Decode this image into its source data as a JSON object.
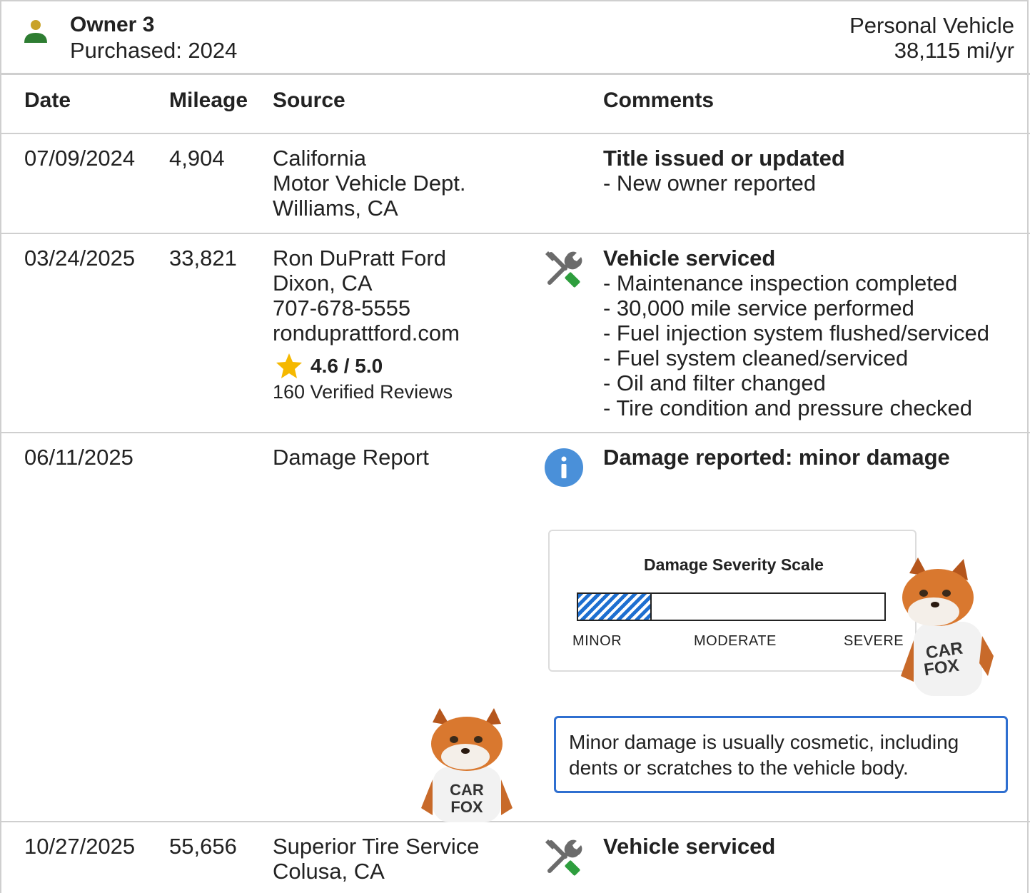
{
  "owner": {
    "title": "Owner 3",
    "purchased": "Purchased: 2024",
    "vehicle_type": "Personal Vehicle",
    "mileage_rate": "38,115 mi/yr"
  },
  "columns": {
    "date": "Date",
    "mileage": "Mileage",
    "source": "Source",
    "comments": "Comments"
  },
  "records": [
    {
      "date": "07/09/2024",
      "mileage": "4,904",
      "source": [
        "California",
        "Motor Vehicle Dept.",
        "Williams, CA"
      ],
      "comment_title": "Title issued or updated",
      "comment_items": [
        "- New owner reported"
      ]
    },
    {
      "date": "03/24/2025",
      "mileage": "33,821",
      "source": [
        "Ron DuPratt Ford",
        "Dixon, CA",
        "707-678-5555",
        "ronduprattford.com"
      ],
      "rating": "4.6 / 5.0",
      "reviews": "160 Verified Reviews",
      "icon": "service-tools-icon",
      "comment_title": "Vehicle serviced",
      "comment_items": [
        "- Maintenance inspection completed",
        "- 30,000 mile service performed",
        "- Fuel injection system flushed/serviced",
        "- Fuel system cleaned/serviced",
        "- Oil and filter changed",
        "- Tire condition and pressure checked"
      ]
    },
    {
      "date": "06/11/2025",
      "mileage": "",
      "source": [
        "Damage Report"
      ],
      "icon": "info-icon",
      "comment_title": "Damage reported: minor damage",
      "damage_scale": {
        "title": "Damage Severity Scale",
        "labels": [
          "MINOR",
          "MODERATE",
          "SEVERE"
        ],
        "level_fraction": 0.24,
        "fill_color": "#1e6fd0"
      },
      "note": "Minor damage is usually cosmetic, including dents or scratches to the vehicle body."
    },
    {
      "date": "10/27/2025",
      "mileage": "55,656",
      "source": [
        "Superior Tire Service",
        "Colusa, CA"
      ],
      "icon": "service-tools-icon",
      "comment_title": "Vehicle serviced"
    }
  ],
  "mascot": {
    "shirt_text_1": "CAR",
    "shirt_text_2": "FOX"
  },
  "colors": {
    "accent_blue": "#2f6fd0",
    "info_blue": "#4a90d9",
    "owner_green": "#2e7d32",
    "owner_gold": "#c9a227",
    "star": "#f5b800",
    "wrench_green": "#2e9e3e"
  }
}
